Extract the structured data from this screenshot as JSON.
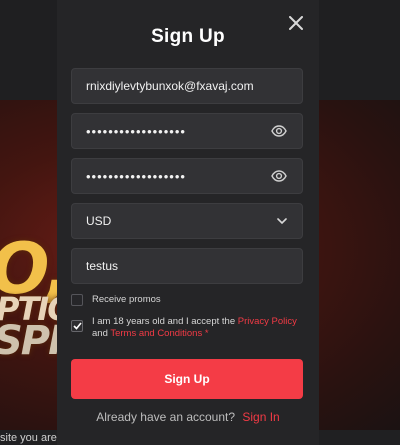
{
  "background": {
    "deco_big": "O,",
    "deco_line1": "PTIO",
    "deco_line2": "SPI",
    "bottom_cut_text": "site you are"
  },
  "modal": {
    "title": "Sign Up",
    "email_value": "rnixdiylevtybunxok@fxavaj.com",
    "password_mask": "••••••••••••••••••",
    "confirm_password_mask": "••••••••••••••••••",
    "currency_value": "USD",
    "promo_code_value": "testus",
    "receive_promos_label": "Receive promos",
    "receive_promos_checked": false,
    "terms_checked": true,
    "terms_text_prefix": "I am 18 years old and I accept the",
    "privacy_policy_link": "Privacy Policy",
    "terms_text_and": "and",
    "terms_conditions_link": "Terms and Conditions",
    "required_mark": "*",
    "submit_label": "Sign Up",
    "already_account_text": "Already have an account?",
    "sign_in_link": "Sign In"
  },
  "icons": {
    "close": "close-icon",
    "eye": "eye-icon",
    "chevron": "chevron-down-icon",
    "check": "check-icon"
  },
  "colors": {
    "accent": "#f43c46",
    "modal_bg": "#252527",
    "field_bg": "#323235"
  }
}
